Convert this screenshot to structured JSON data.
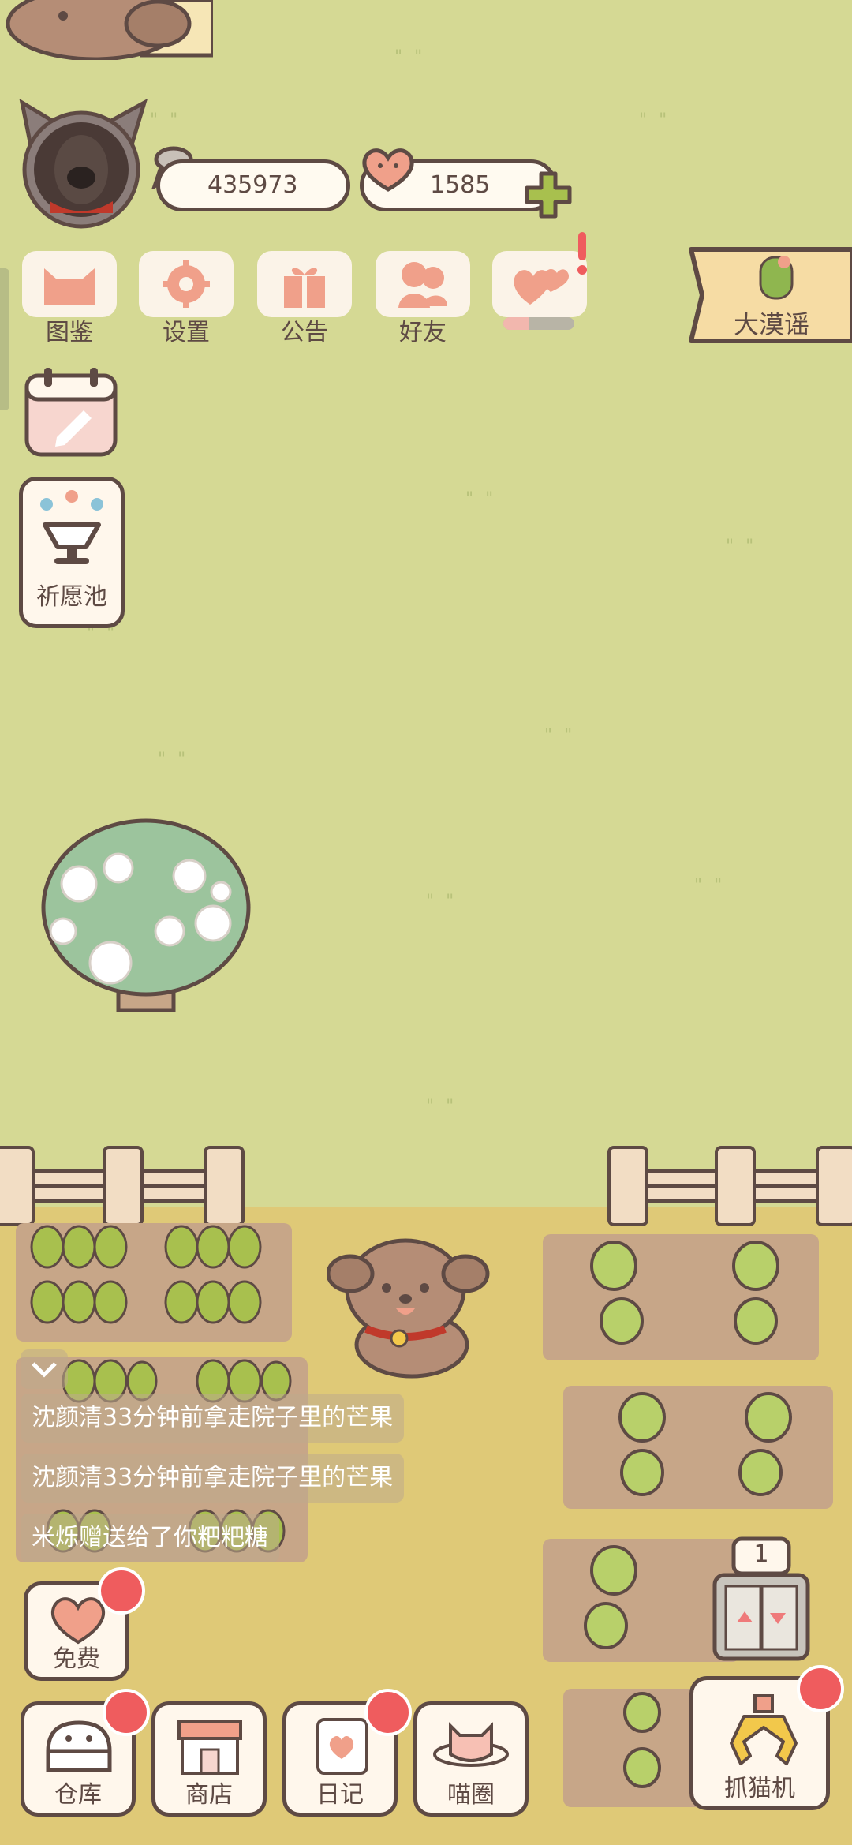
{
  "player": {
    "fish_count": "435973",
    "heart_count": "1585"
  },
  "menu": {
    "collection": "图鉴",
    "settings": "设置",
    "notice": "公告",
    "friends": "好友"
  },
  "event_banner": {
    "label": "大漠谣"
  },
  "wishing_pool": {
    "label": "祈愿池"
  },
  "feed": [
    "沈颜清33分钟前拿走院子里的芒果",
    "沈颜清33分钟前拿走院子里的芒果",
    "米烁赠送给了你粑粑糖"
  ],
  "free": {
    "label": "免费"
  },
  "bottom_bar": {
    "warehouse": "仓库",
    "shop": "商店",
    "diary": "日记",
    "meow_circle": "喵圈",
    "claw_machine": "抓猫机"
  },
  "elevator": {
    "floor": "1"
  },
  "colors": {
    "grass": "#d5d994",
    "dirt": "#dfc977",
    "accent": "#f0a08a",
    "outline": "#5e4a44",
    "badge": "#ef5c5e"
  }
}
